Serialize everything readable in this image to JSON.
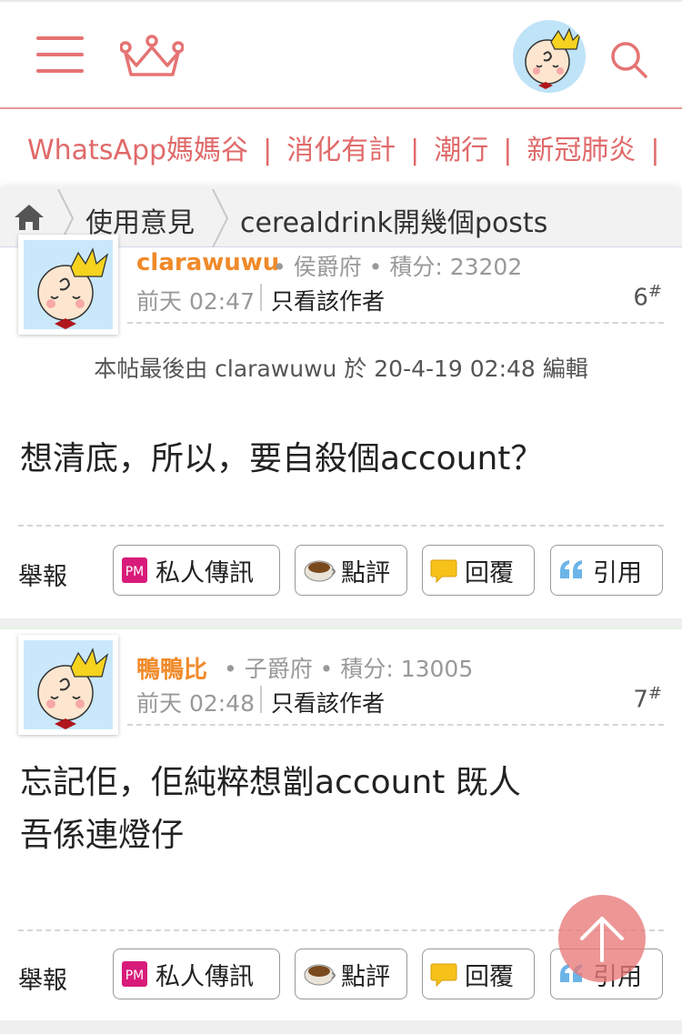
{
  "header": {
    "menu_icon": "hamburger-icon",
    "logo_icon": "crown-icon",
    "avatar_icon": "baby-avatar",
    "search_icon": "search-icon"
  },
  "tags": [
    "WhatsApp媽媽谷",
    "消化有計",
    "潮行",
    "新冠肺炎"
  ],
  "breadcrumb": {
    "home_icon": "home-icon",
    "item1": "使用意見",
    "item2": "cerealdrink開幾個posts"
  },
  "posts": [
    {
      "username": "clarawuwu",
      "meta": "• 侯爵府 • 積分: 23202",
      "time": "前天 02:47",
      "author_only": "只看該作者",
      "floor": "6",
      "floor_mark": "#",
      "edit_note": "本帖最後由 clarawuwu 於 20-4-19 02:48 編輯",
      "content": [
        "想清底，所以，要自殺個account？"
      ]
    },
    {
      "username": "鴨鴨比",
      "meta": "• 子爵府 • 積分: 13005",
      "time": "前天 02:48",
      "author_only": "只看該作者",
      "floor": "7",
      "floor_mark": "#",
      "content": [
        "忘記佢，佢純粹想劏account 既人",
        "吾係連燈仔"
      ]
    }
  ],
  "actions": {
    "report": "舉報",
    "pm": "私人傳訊",
    "comment": "點評",
    "reply": "回覆",
    "quote": "引用"
  },
  "colors": {
    "accent": "#e57373",
    "username": "#f08a2a"
  },
  "fab_icon": "arrow-up-icon"
}
